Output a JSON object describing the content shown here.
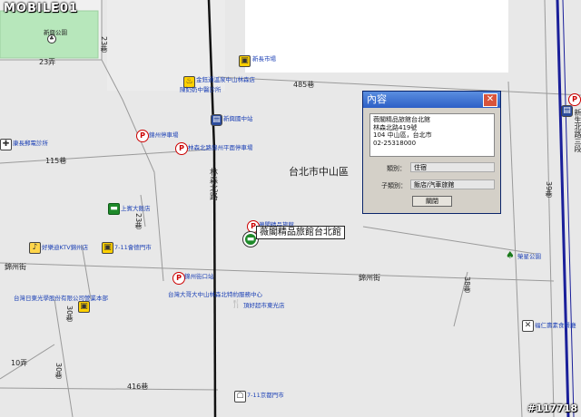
{
  "watermark": "MOBILE01",
  "image_id": "#117718",
  "district": "台北市中山區",
  "callout": "薇閣精品旅館台北館",
  "popup": {
    "title": "內容",
    "close_icon": "close-icon",
    "address_lines": [
      "薇閣精品旅館台北館",
      "林森北路419號",
      "104 中山區，台北市",
      "02-25318000"
    ],
    "category_label": "類別：",
    "category_value": "住宿",
    "subcategory_label": "子類別：",
    "subcategory_value": "飯店/汽車旅館",
    "close_button": "關閉"
  },
  "streets": {
    "s23": "23弄",
    "s23b": "23巷",
    "s485": "485巷",
    "s115": "115巷",
    "linsen": "林森北路",
    "s23c": "23巷",
    "jinzhou_w": "錦州街",
    "jinzhou_c": "錦州街",
    "s30": "30巷",
    "s301": "30巷",
    "s10": "10弄",
    "s30a": "30巷",
    "s416": "416巷",
    "s38": "38巷",
    "xinsheng": "新生北路三段",
    "s39": "39巷"
  },
  "pois": [
    {
      "text": "新興公園",
      "icon": "park-icon"
    },
    {
      "text": "新長市場",
      "icon": "market-icon"
    },
    {
      "text": "金鈺通溫泉中山林森店",
      "icon": "hotspring-icon"
    },
    {
      "text": "陳奶奶中醫診所",
      "icon": "clinic-icon"
    },
    {
      "text": "新興國中站",
      "icon": "bus-stop-icon"
    },
    {
      "text": "錦州停車場",
      "icon": "parking-icon"
    },
    {
      "text": "林森北路錦州平面停車場",
      "icon": "parking-icon"
    },
    {
      "text": "康長郵電診所",
      "icon": "clinic-icon"
    },
    {
      "text": "上賓大飯店",
      "icon": "hotel-icon"
    },
    {
      "text": "好樂迪KTV錦州店",
      "icon": "ktv-icon"
    },
    {
      "text": "7-11會德門市",
      "icon": "convenience-store-icon"
    },
    {
      "text": "瀞閣精品旅館",
      "icon": "parking-icon"
    },
    {
      "text": "錦州街口站",
      "icon": "bus-stop-icon"
    },
    {
      "text": "台灣日東光學股份有限公司營業本部",
      "icon": "office-icon"
    },
    {
      "text": "台灣大哥大中山林森北特約服務中心",
      "icon": "office-icon"
    },
    {
      "text": "頂好超市東光店",
      "icon": "supermarket-icon"
    },
    {
      "text": "7-11京都門市",
      "icon": "convenience-store-icon"
    },
    {
      "text": "榮星公園",
      "icon": "park-icon"
    },
    {
      "text": "福仁壽素食餐廳",
      "icon": "restaurant-icon"
    }
  ]
}
